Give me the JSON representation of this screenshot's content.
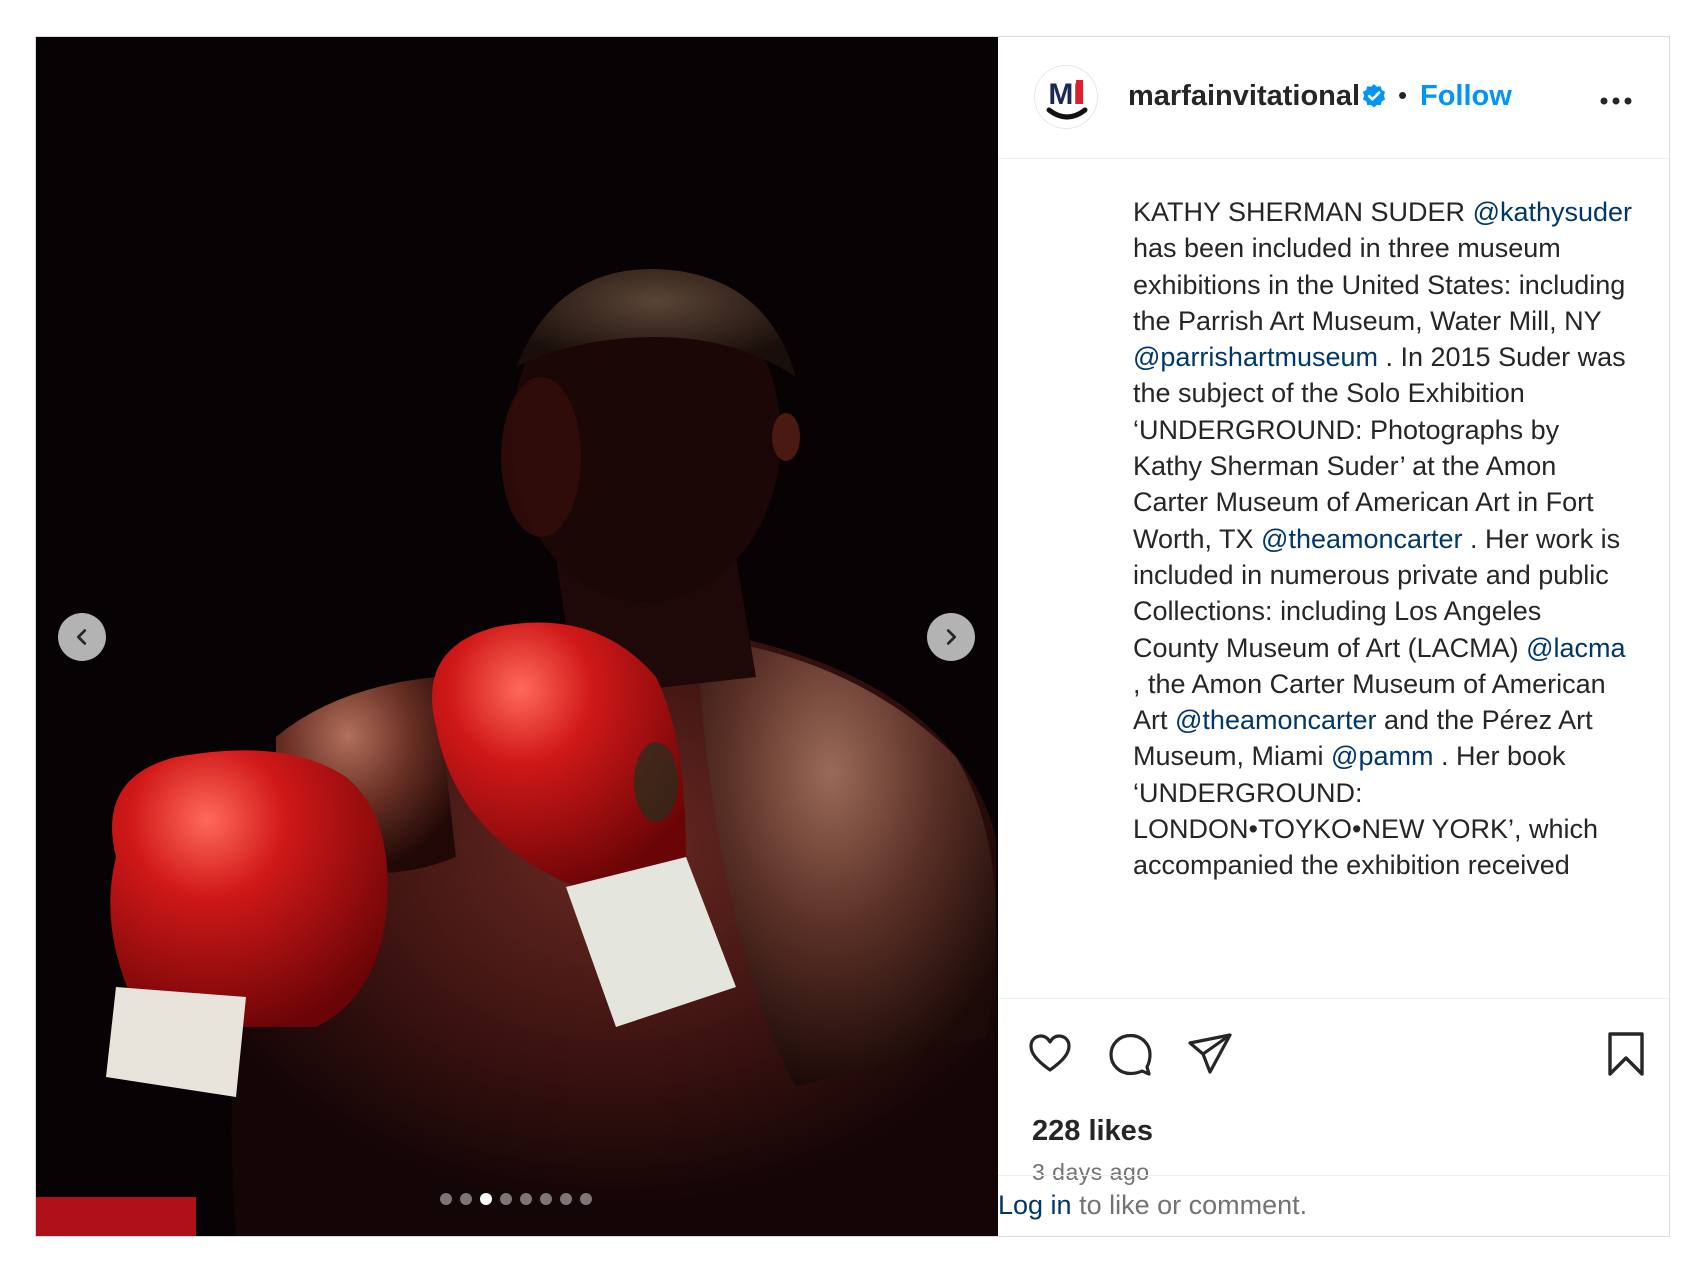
{
  "post": {
    "username": "marfainvitational",
    "follow_label": "Follow",
    "bullet": "•",
    "avatar_text": "MI",
    "image_alt": "Boxer with red gloves in dramatic lighting",
    "carousel": {
      "count": 8,
      "active_index": 2
    },
    "caption": {
      "segments": [
        {
          "t": "KATHY SHERMAN SUDER "
        },
        {
          "t": "@kathysuder",
          "mention": true
        },
        {
          "t": " has been included in three museum exhibitions in the United States: including the Parrish Art Museum, Water Mill, NY "
        },
        {
          "t": "@parrishartmuseum",
          "mention": true
        },
        {
          "t": " . In 2015 Suder was the subject of the Solo Exhibition ‘UNDERGROUND: Photographs by Kathy Sherman Suder’ at the Amon Carter Museum of American Art in Fort Worth, TX "
        },
        {
          "t": "@theamoncarter",
          "mention": true
        },
        {
          "t": " . Her work is included in numerous private and public Collections: including Los Angeles County Museum of Art (LACMA) "
        },
        {
          "t": "@lacma",
          "mention": true
        },
        {
          "t": " , the Amon Carter Museum of American Art "
        },
        {
          "t": "@theamoncarter",
          "mention": true
        },
        {
          "t": " and the Pérez Art Museum, Miami "
        },
        {
          "t": "@pamm",
          "mention": true
        },
        {
          "t": " . Her book ‘UNDERGROUND: LONDON•TOYKO•NEW YORK’, which accompanied the exhibition received"
        }
      ]
    },
    "likes_text": "228 likes",
    "time_text": "3 days ago",
    "login": {
      "link": "Log in",
      "rest": " to like or comment."
    }
  },
  "icons": {
    "verified": "verified-badge-icon",
    "more": "more-options-icon",
    "like": "heart-icon",
    "comment": "comment-icon",
    "share": "share-icon",
    "save": "bookmark-icon",
    "prev": "chevron-left-icon",
    "next": "chevron-right-icon"
  },
  "colors": {
    "link_blue": "#0095f6",
    "mention_blue": "#00376b",
    "verified_blue": "#0095f6",
    "text": "#262626",
    "muted": "#737373",
    "glove_red": "#c8141a"
  }
}
